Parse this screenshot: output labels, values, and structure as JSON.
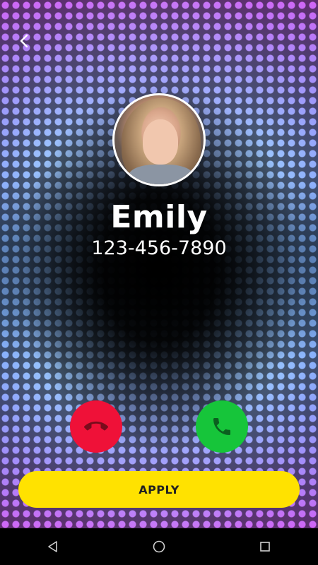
{
  "caller": {
    "name": "Emily",
    "phone": "123-456-7890"
  },
  "actions": {
    "apply_label": "APPLY"
  },
  "icons": {
    "back": "chevron-left-icon",
    "decline": "phone-hangup-icon",
    "accept": "phone-icon",
    "nav_back": "triangle-back-icon",
    "nav_home": "circle-home-icon",
    "nav_recents": "square-recents-icon"
  },
  "colors": {
    "decline": "#ef1138",
    "accept": "#16c53a",
    "apply": "#ffe200",
    "navbar": "#000000",
    "text": "#ffffff"
  }
}
